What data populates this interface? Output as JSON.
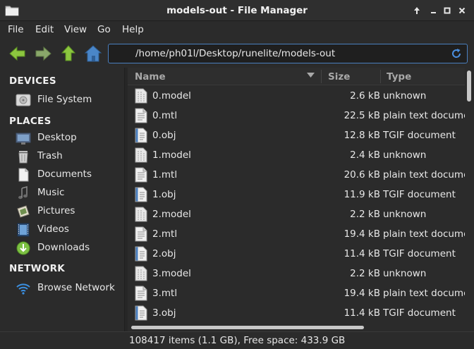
{
  "window": {
    "title": "models-out - File Manager"
  },
  "menu": [
    "File",
    "Edit",
    "View",
    "Go",
    "Help"
  ],
  "toolbar": {
    "path": "/home/ph01l/Desktop/runelite/models-out"
  },
  "sidebar": {
    "devices_heading": "DEVICES",
    "devices": [
      {
        "label": "File System",
        "icon": "drive-icon"
      }
    ],
    "places_heading": "PLACES",
    "places": [
      {
        "label": "Desktop",
        "icon": "desktop-icon"
      },
      {
        "label": "Trash",
        "icon": "trash-icon"
      },
      {
        "label": "Documents",
        "icon": "documents-icon"
      },
      {
        "label": "Music",
        "icon": "music-icon"
      },
      {
        "label": "Pictures",
        "icon": "pictures-icon"
      },
      {
        "label": "Videos",
        "icon": "videos-icon"
      },
      {
        "label": "Downloads",
        "icon": "downloads-icon"
      }
    ],
    "network_heading": "NETWORK",
    "network": [
      {
        "label": "Browse Network",
        "icon": "wifi-icon"
      }
    ]
  },
  "columns": {
    "name": "Name",
    "size": "Size",
    "type": "Type"
  },
  "files": [
    {
      "name": "0.model",
      "size": "2.6 kB",
      "type": "unknown",
      "icon": "unknown-file-icon"
    },
    {
      "name": "0.mtl",
      "size": "22.5 kB",
      "type": "plain text document",
      "icon": "text-file-icon"
    },
    {
      "name": "0.obj",
      "size": "12.8 kB",
      "type": "TGIF document",
      "icon": "tgif-file-icon"
    },
    {
      "name": "1.model",
      "size": "2.4 kB",
      "type": "unknown",
      "icon": "unknown-file-icon"
    },
    {
      "name": "1.mtl",
      "size": "20.6 kB",
      "type": "plain text document",
      "icon": "text-file-icon"
    },
    {
      "name": "1.obj",
      "size": "11.9 kB",
      "type": "TGIF document",
      "icon": "tgif-file-icon"
    },
    {
      "name": "2.model",
      "size": "2.2 kB",
      "type": "unknown",
      "icon": "unknown-file-icon"
    },
    {
      "name": "2.mtl",
      "size": "19.4 kB",
      "type": "plain text document",
      "icon": "text-file-icon"
    },
    {
      "name": "2.obj",
      "size": "11.4 kB",
      "type": "TGIF document",
      "icon": "tgif-file-icon"
    },
    {
      "name": "3.model",
      "size": "2.2 kB",
      "type": "unknown",
      "icon": "unknown-file-icon"
    },
    {
      "name": "3.mtl",
      "size": "19.4 kB",
      "type": "plain text document",
      "icon": "text-file-icon"
    },
    {
      "name": "3.obj",
      "size": "11.4 kB",
      "type": "TGIF document",
      "icon": "tgif-file-icon"
    }
  ],
  "status": "108417 items (1.1 GB), Free space: 433.9 GB",
  "colors": {
    "background": "#2b2b2b",
    "text": "#e8e8e8",
    "nav_arrow": "#7fbf3f",
    "home": "#4a86c8",
    "path_focus": "#4a7fbf"
  }
}
